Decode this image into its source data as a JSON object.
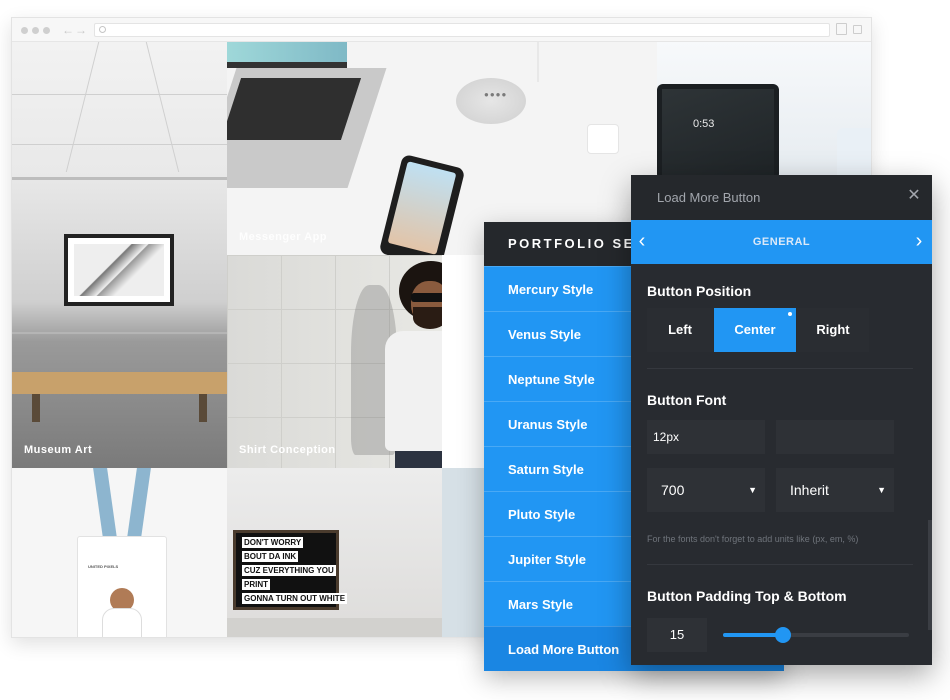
{
  "gallery": {
    "tiles": [
      {
        "caption": "Museum Art"
      },
      {
        "caption": "Messenger App"
      },
      {
        "caption": "Shirt Conception"
      }
    ],
    "tablet_time": "0:53",
    "badge_text": "UNITED PIXELS",
    "poster_lines": [
      "DON'T WORRY",
      "BOUT DA INK",
      "CUZ EVERYTHING YOU",
      "PRINT",
      "GONNA TURN OUT WHITE"
    ]
  },
  "sections_panel": {
    "title": "PORTFOLIO SECTIONS",
    "items": [
      {
        "label": "Mercury Style"
      },
      {
        "label": "Venus Style"
      },
      {
        "label": "Neptune Style"
      },
      {
        "label": "Uranus Style"
      },
      {
        "label": "Saturn Style"
      },
      {
        "label": "Pluto Style"
      },
      {
        "label": "Jupiter Style"
      },
      {
        "label": "Mars Style"
      },
      {
        "label": "Load More Button"
      }
    ],
    "active": "Load More Button"
  },
  "settings_panel": {
    "title": "Load More Button",
    "tab": "GENERAL",
    "position": {
      "label": "Button Position",
      "options": [
        "Left",
        "Center",
        "Right"
      ],
      "selected": "Center"
    },
    "font": {
      "label": "Button Font",
      "size": "12px",
      "weight": "700",
      "family": "Inherit",
      "hint": "For the fonts don't forget to add units like (px, em, %)"
    },
    "padding": {
      "label": "Button Padding Top & Bottom",
      "value": "15",
      "slider_fraction": 0.32
    }
  },
  "colors": {
    "accent": "#2196f3",
    "panel_bg": "#282b30",
    "panel_header": "#25282c"
  }
}
